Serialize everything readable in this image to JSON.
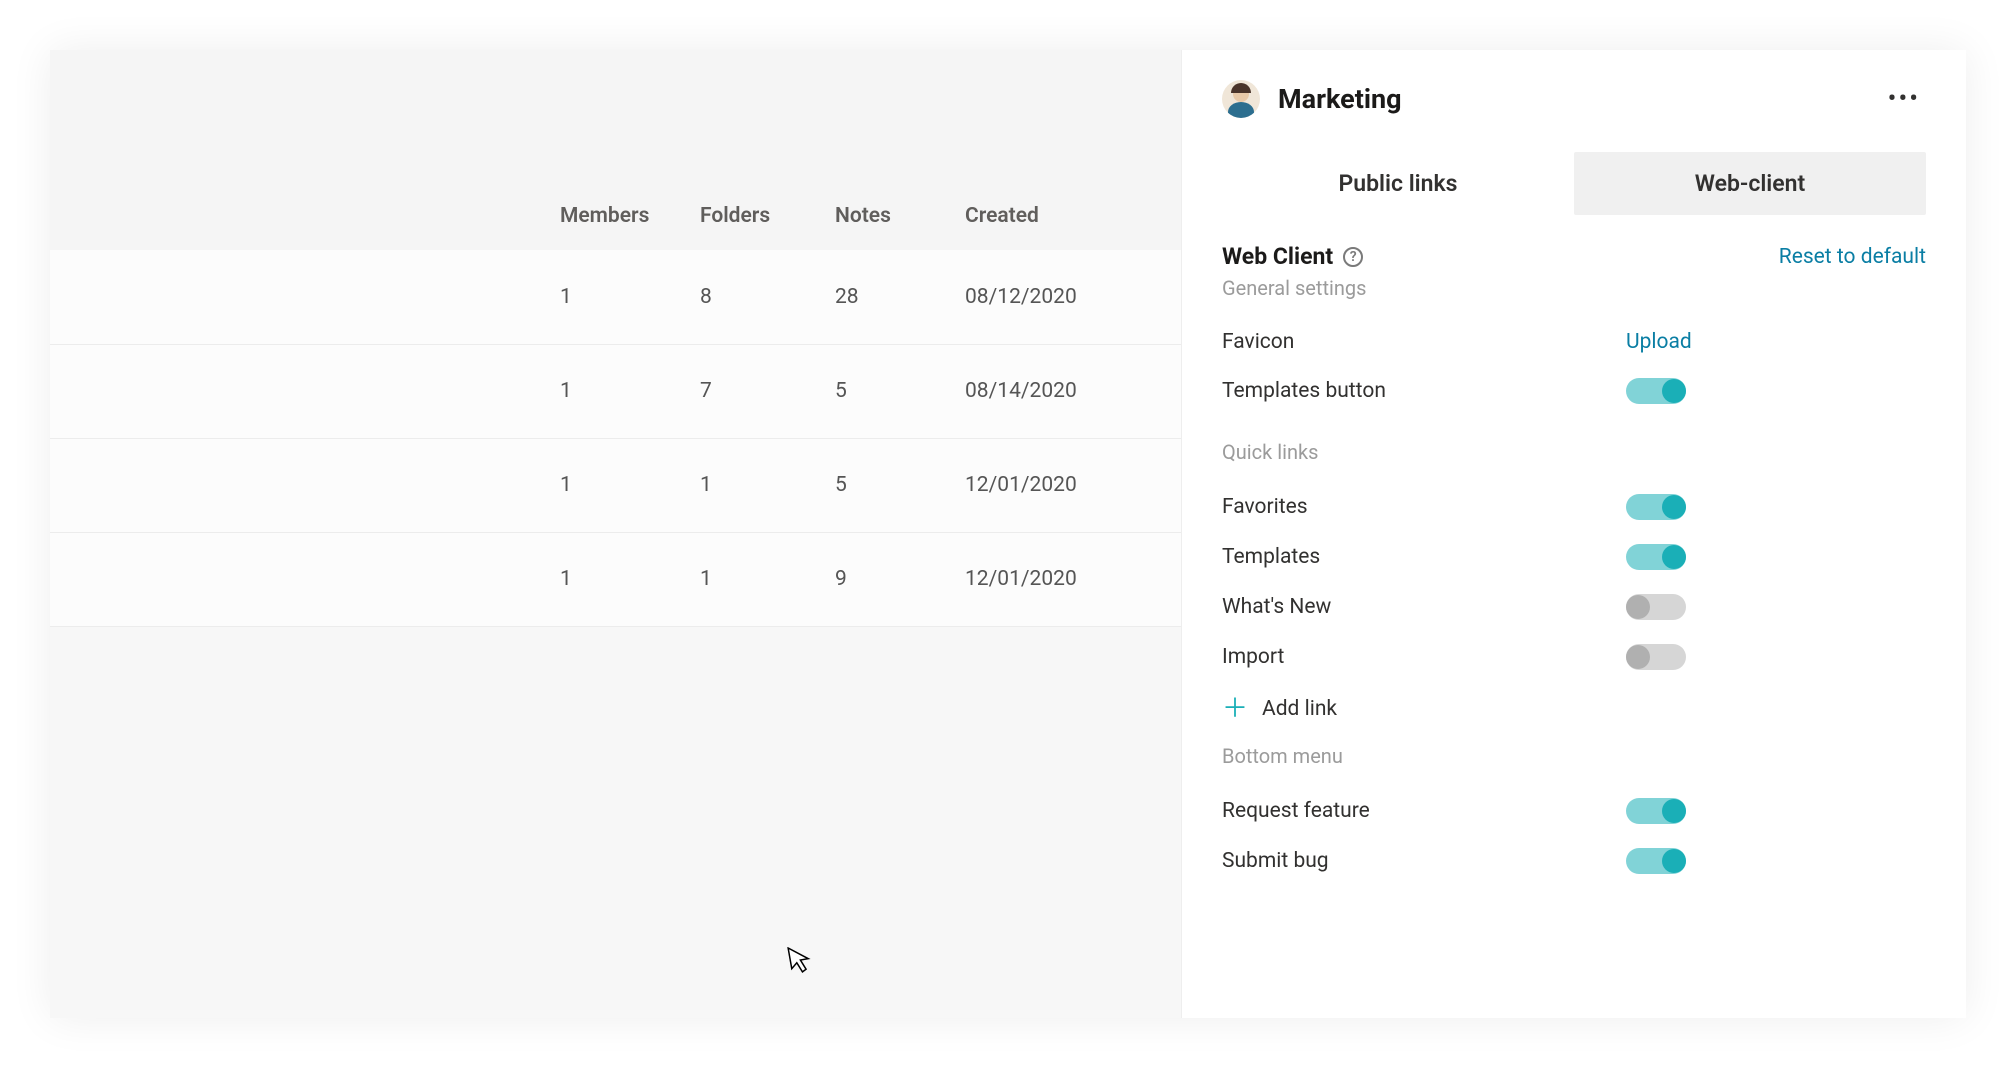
{
  "table": {
    "headers": {
      "members": "Members",
      "folders": "Folders",
      "notes": "Notes",
      "created": "Created"
    },
    "rows": [
      {
        "members": "1",
        "folders": "8",
        "notes": "28",
        "created": "08/12/2020"
      },
      {
        "members": "1",
        "folders": "7",
        "notes": "5",
        "created": "08/14/2020"
      },
      {
        "members": "1",
        "folders": "1",
        "notes": "5",
        "created": "12/01/2020"
      },
      {
        "members": "1",
        "folders": "1",
        "notes": "9",
        "created": "12/01/2020"
      }
    ]
  },
  "panel": {
    "title": "Marketing",
    "tabs": {
      "public_links": "Public links",
      "web_client": "Web-client"
    },
    "section_title": "Web Client",
    "reset": "Reset to default",
    "general_settings_label": "General settings",
    "favicon_label": "Favicon",
    "favicon_action": "Upload",
    "templates_button_label": "Templates button",
    "templates_button_on": true,
    "quick_links_label": "Quick links",
    "favorites_label": "Favorites",
    "favorites_on": true,
    "templates_label": "Templates",
    "templates_on": true,
    "whats_new_label": "What's New",
    "whats_new_on": false,
    "import_label": "Import",
    "import_on": false,
    "add_link_label": "Add link",
    "bottom_menu_label": "Bottom menu",
    "request_feature_label": "Request feature",
    "request_feature_on": true,
    "submit_bug_label": "Submit bug",
    "submit_bug_on": true
  }
}
